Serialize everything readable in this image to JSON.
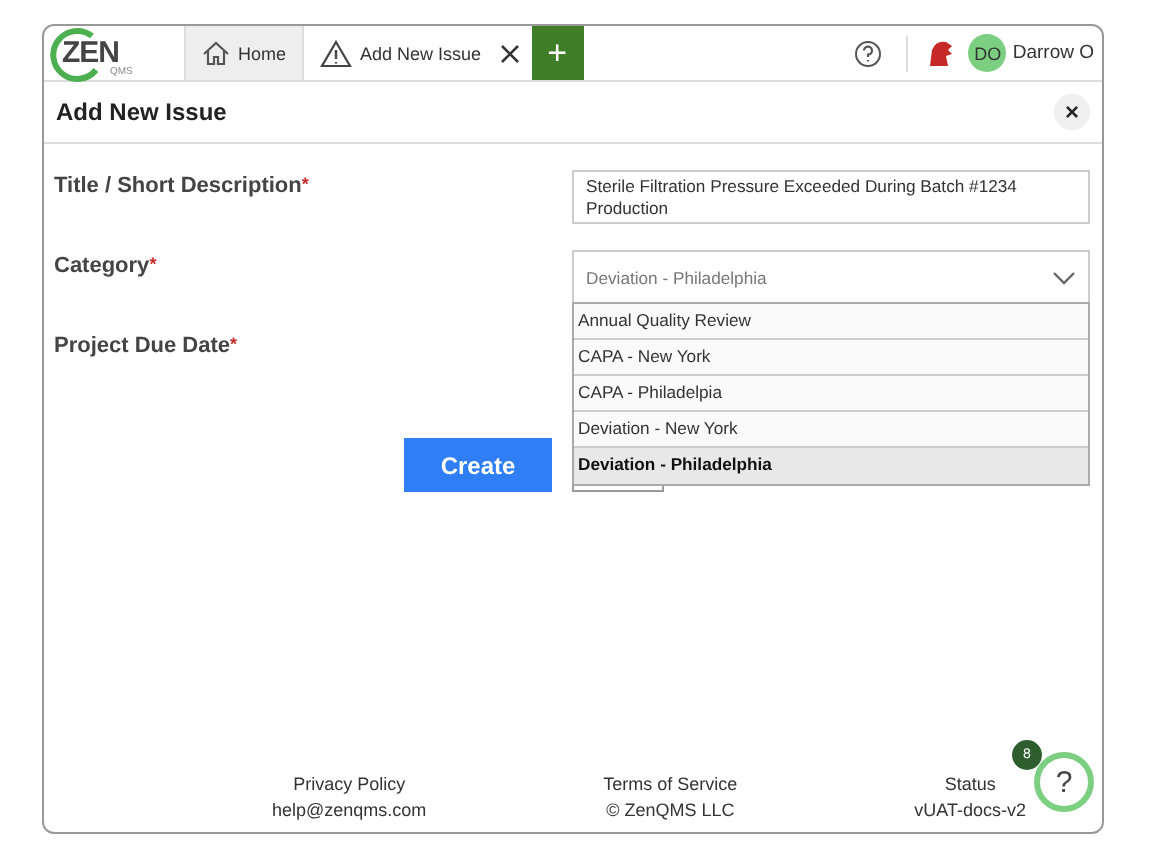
{
  "app": {
    "logo": "ZEN",
    "logo_sub": "QMS"
  },
  "tabs": [
    {
      "label": "Home",
      "selected": false,
      "closable": false
    },
    {
      "label": "Add New Issue",
      "selected": true,
      "closable": true
    }
  ],
  "add_tab": "+",
  "user": {
    "initials": "DO",
    "name": "Darrow O"
  },
  "dialog": {
    "title": "Add New Issue",
    "close": "×"
  },
  "fields": [
    {
      "kind": "text",
      "label": "Title / Short Description",
      "required_mark": "*",
      "value": "Sterile Filtration Pressure Exceeded During Batch #1234 Production"
    },
    {
      "kind": "select",
      "label": "Category",
      "required_mark": "*",
      "value": "Deviation - Philadelphia",
      "expanded": true,
      "options": [
        {
          "label": "Annual Quality Review",
          "selected": false
        },
        {
          "label": "CAPA - New York",
          "selected": false
        },
        {
          "label": "CAPA - Philadelpia",
          "selected": false
        },
        {
          "label": "Deviation - New York",
          "selected": false
        },
        {
          "label": "Deviation - Philadelphia",
          "selected": true
        }
      ]
    },
    {
      "kind": "date",
      "label": "Project Due Date",
      "required_mark": "*"
    }
  ],
  "create_button": "Create",
  "footer": [
    [
      "Privacy Policy",
      "help@zenqms.com"
    ],
    [
      "Terms of Service",
      "© ZenQMS LLC"
    ],
    [
      "Status",
      "vUAT-docs-v2"
    ]
  ],
  "help": {
    "label": "?",
    "badge": "8"
  }
}
